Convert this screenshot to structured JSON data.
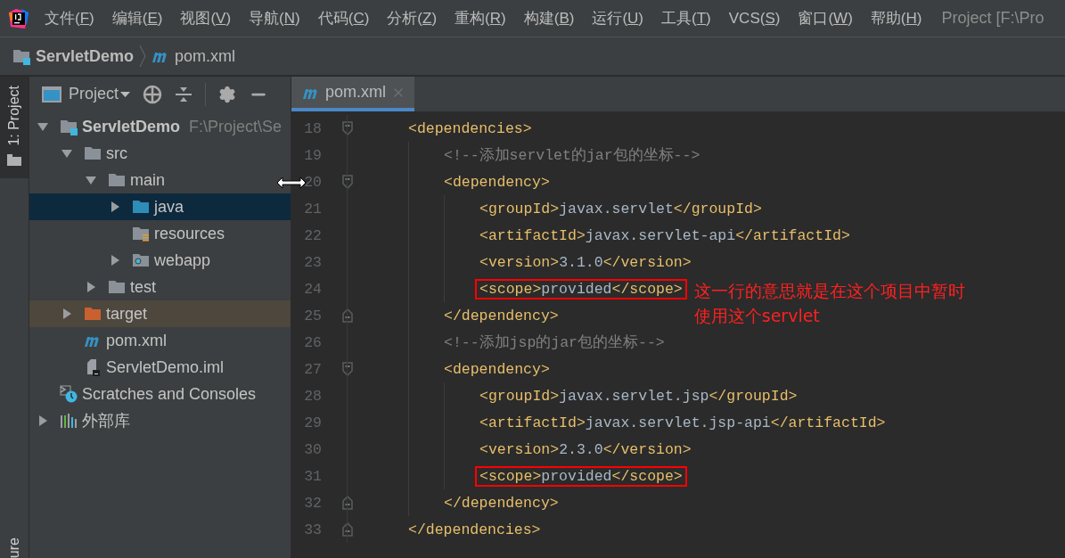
{
  "menu_bar": {
    "items": [
      {
        "label": "文件(",
        "mnemonic": "F",
        "suffix": ")"
      },
      {
        "label": "编辑(",
        "mnemonic": "E",
        "suffix": ")"
      },
      {
        "label": "视图(",
        "mnemonic": "V",
        "suffix": ")"
      },
      {
        "label": "导航(",
        "mnemonic": "N",
        "suffix": ")"
      },
      {
        "label": "代码(",
        "mnemonic": "C",
        "suffix": ")"
      },
      {
        "label": "分析(",
        "mnemonic": "Z",
        "suffix": ")"
      },
      {
        "label": "重构(",
        "mnemonic": "R",
        "suffix": ")"
      },
      {
        "label": "构建(",
        "mnemonic": "B",
        "suffix": ")"
      },
      {
        "label": "运行(",
        "mnemonic": "U",
        "suffix": ")"
      },
      {
        "label": "工具(",
        "mnemonic": "T",
        "suffix": ")"
      },
      {
        "label": "VCS(",
        "mnemonic": "S",
        "suffix": ")"
      },
      {
        "label": "窗口(",
        "mnemonic": "W",
        "suffix": ")"
      },
      {
        "label": "帮助(",
        "mnemonic": "H",
        "suffix": ")"
      }
    ],
    "window_title": "Project [F:\\Pro"
  },
  "breadcrumb": [
    {
      "kind": "module",
      "label": "ServletDemo"
    },
    {
      "kind": "maven",
      "label": "pom.xml"
    }
  ],
  "left_stripe": {
    "tabs": [
      {
        "label": "1: Project",
        "selected": true
      }
    ],
    "bottom_tab": "ure"
  },
  "project_panel": {
    "title": "Project",
    "tree": [
      {
        "kind": "module",
        "label": "ServletDemo",
        "path": "F:\\Project\\Se",
        "expanded": true,
        "selected": false,
        "highlighted": false,
        "children": [
          {
            "kind": "folder",
            "label": "src",
            "expanded": true,
            "selected": false,
            "highlighted": false,
            "children": [
              {
                "kind": "folder",
                "label": "main",
                "expanded": true,
                "selected": false,
                "highlighted": false,
                "children": [
                  {
                    "kind": "source-folder",
                    "label": "java",
                    "expanded": false,
                    "selected": true,
                    "highlighted": false
                  },
                  {
                    "kind": "resources-folder",
                    "label": "resources",
                    "selected": false,
                    "highlighted": false
                  },
                  {
                    "kind": "web-folder",
                    "label": "webapp",
                    "expanded": false,
                    "selected": false,
                    "highlighted": false
                  }
                ]
              },
              {
                "kind": "folder",
                "label": "test",
                "expanded": false,
                "selected": false,
                "highlighted": false
              }
            ]
          },
          {
            "kind": "excluded-folder",
            "label": "target",
            "expanded": false,
            "selected": false,
            "highlighted": true
          },
          {
            "kind": "maven",
            "label": "pom.xml",
            "selected": false,
            "highlighted": false
          },
          {
            "kind": "iml",
            "label": "ServletDemo.iml",
            "selected": false,
            "highlighted": false
          }
        ]
      },
      {
        "kind": "scratches",
        "label": "Scratches and Consoles",
        "selected": false,
        "highlighted": false
      },
      {
        "kind": "libraries",
        "label": "外部库",
        "expanded": false,
        "selected": false,
        "highlighted": false
      }
    ]
  },
  "editor": {
    "tabs": [
      {
        "label": "pom.xml",
        "selected": true
      }
    ],
    "lines": [
      {
        "number": "18",
        "fold_start": true,
        "segments": [
          {
            "kind": "tag",
            "text": "<dependencies>"
          }
        ],
        "children": [
          {
            "number": "19",
            "segments": [
              {
                "kind": "comment",
                "text": "<!--添加servlet的jar包的坐标-->"
              }
            ]
          },
          {
            "number": "20",
            "fold_start": true,
            "segments": [
              {
                "kind": "tag",
                "text": "<dependency>"
              }
            ],
            "children": [
              {
                "number": "21",
                "segments": [
                  {
                    "kind": "tag",
                    "text": "<groupId>"
                  },
                  {
                    "kind": "value",
                    "text": "javax.servlet"
                  },
                  {
                    "kind": "tag",
                    "text": "</groupId>"
                  }
                ]
              },
              {
                "number": "22",
                "segments": [
                  {
                    "kind": "tag",
                    "text": "<artifactId>"
                  },
                  {
                    "kind": "value",
                    "text": "javax.servlet-api"
                  },
                  {
                    "kind": "tag",
                    "text": "</artifactId>"
                  }
                ]
              },
              {
                "number": "23",
                "segments": [
                  {
                    "kind": "tag",
                    "text": "<version>"
                  },
                  {
                    "kind": "value",
                    "text": "3.1.0"
                  },
                  {
                    "kind": "tag",
                    "text": "</version>"
                  }
                ]
              },
              {
                "number": "24",
                "boxed": true,
                "note": "这一行的意思就是在这个项目中暂时使用这个servlet",
                "segments": [
                  {
                    "kind": "tag",
                    "text": "<scope>"
                  },
                  {
                    "kind": "value",
                    "text": "provided"
                  },
                  {
                    "kind": "tag",
                    "text": "</scope>"
                  }
                ]
              }
            ]
          },
          {
            "number": "25",
            "fold_end": true,
            "segments": [
              {
                "kind": "tag",
                "text": "</dependency>"
              }
            ]
          },
          {
            "number": "26",
            "segments": [
              {
                "kind": "comment",
                "text": "<!--添加jsp的jar包的坐标-->"
              }
            ]
          },
          {
            "number": "27",
            "fold_start": true,
            "segments": [
              {
                "kind": "tag",
                "text": "<dependency>"
              }
            ],
            "children": [
              {
                "number": "28",
                "segments": [
                  {
                    "kind": "tag",
                    "text": "<groupId>"
                  },
                  {
                    "kind": "value",
                    "text": "javax.servlet.jsp"
                  },
                  {
                    "kind": "tag",
                    "text": "</groupId>"
                  }
                ]
              },
              {
                "number": "29",
                "segments": [
                  {
                    "kind": "tag",
                    "text": "<artifactId>"
                  },
                  {
                    "kind": "value",
                    "text": "javax.servlet.jsp-api"
                  },
                  {
                    "kind": "tag",
                    "text": "</artifactId>"
                  }
                ]
              },
              {
                "number": "30",
                "segments": [
                  {
                    "kind": "tag",
                    "text": "<version>"
                  },
                  {
                    "kind": "value",
                    "text": "2.3.0"
                  },
                  {
                    "kind": "tag",
                    "text": "</version>"
                  }
                ]
              },
              {
                "number": "31",
                "boxed": true,
                "segments": [
                  {
                    "kind": "tag",
                    "text": "<scope>"
                  },
                  {
                    "kind": "value",
                    "text": "provided"
                  },
                  {
                    "kind": "tag",
                    "text": "</scope>"
                  }
                ]
              }
            ]
          },
          {
            "number": "32",
            "fold_end": true,
            "segments": [
              {
                "kind": "tag",
                "text": "</dependency>"
              }
            ]
          }
        ]
      },
      {
        "number": "33",
        "fold_end": true,
        "segments": [
          {
            "kind": "tag",
            "text": "</dependencies>"
          }
        ]
      }
    ]
  }
}
